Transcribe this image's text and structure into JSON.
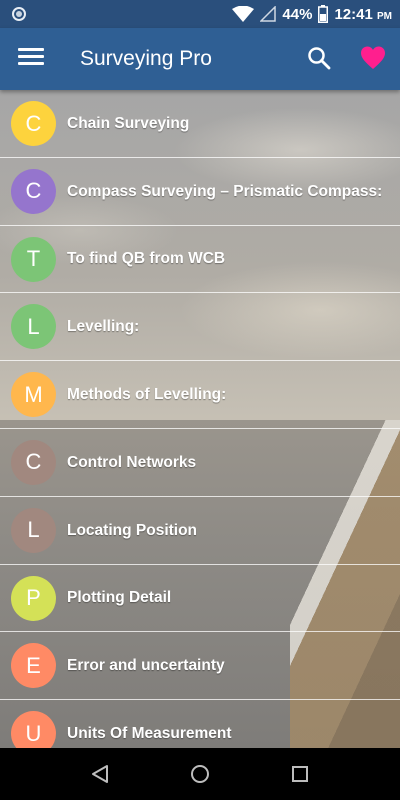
{
  "status_bar": {
    "battery": "44%",
    "time": "12:41",
    "time_suffix": "PM"
  },
  "app_bar": {
    "title": "Surveying Pro",
    "menu_icon": "hamburger-menu-icon",
    "search_icon": "search-icon",
    "favorite_icon": "heart-icon",
    "favorite_color": "#ff1f8e"
  },
  "list": {
    "items": [
      {
        "letter": "C",
        "title": "Chain Surveying",
        "color": "#fdd33d"
      },
      {
        "letter": "C",
        "title": "Compass Surveying – Prismatic Compass:",
        "color": "#9575cd"
      },
      {
        "letter": "T",
        "title": "To find QB from WCB",
        "color": "#7cc576"
      },
      {
        "letter": "L",
        "title": "Levelling:",
        "color": "#7cc576"
      },
      {
        "letter": "M",
        "title": "Methods of Levelling:",
        "color": "#ffb74d"
      },
      {
        "letter": "C",
        "title": "Control Networks",
        "color": "#a1887f"
      },
      {
        "letter": "L",
        "title": "Locating Position",
        "color": "#a1887f"
      },
      {
        "letter": "P",
        "title": "Plotting Detail",
        "color": "#d4e157"
      },
      {
        "letter": "E",
        "title": "Error and uncertainty",
        "color": "#ff8a65"
      },
      {
        "letter": "U",
        "title": "Units Of Measurement",
        "color": "#ff8a65"
      }
    ]
  },
  "nav_bar": {
    "back_icon": "back-triangle-icon",
    "home_icon": "home-circle-icon",
    "recents_icon": "recents-square-icon"
  }
}
